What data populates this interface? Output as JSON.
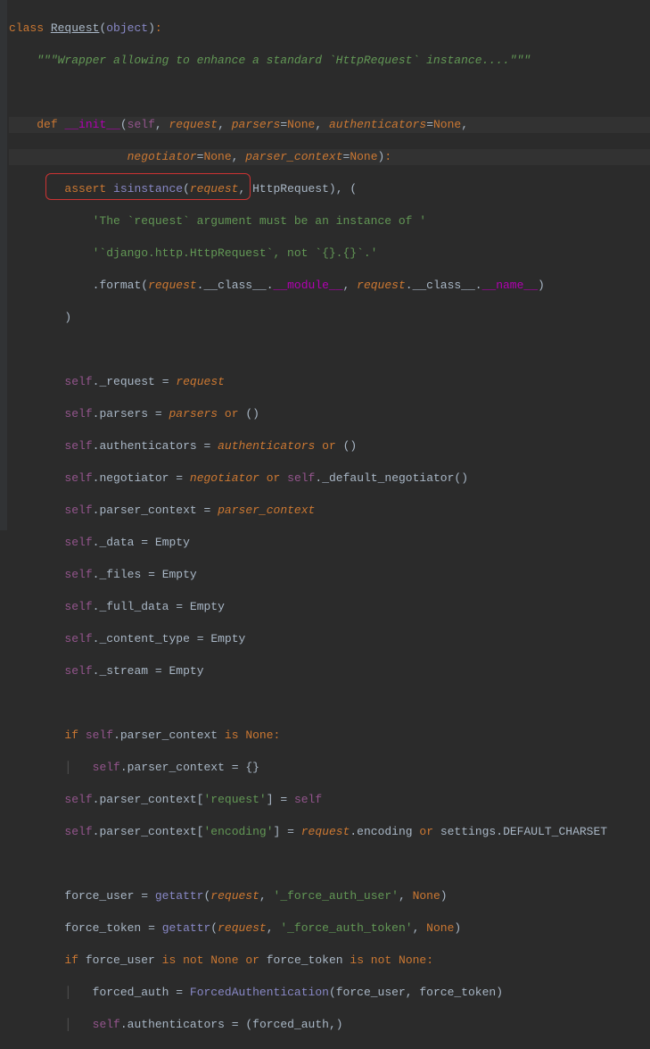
{
  "code": {
    "l1_class": "class",
    "l1_name": "Request",
    "l1_obj": "object",
    "l2_docstr": "\"\"\"Wrapper allowing to enhance a standard `HttpRequest` instance....\"\"\"",
    "l4_def": "def",
    "l4_name": "__init__",
    "l4_self": "self",
    "l4_req": "request",
    "l4_parsers": "parsers",
    "l4_none": "None",
    "l4_auth": "authenticators",
    "l5_neg": "negotiator",
    "l5_pc": "parser_context",
    "l6_assert": "assert",
    "l6_isinst": "isinstance",
    "l6_req": "request",
    "l6_http": "HttpRequest",
    "l7_str": "'The `request` argument must be an instance of '",
    "l8_str": "'`django.http.HttpRequest`, not `{}.{}`.'",
    "l9_format": "format",
    "l9_req": "request",
    "l9_class": "__class__",
    "l9_module": "__module__",
    "l9_name": "__name__",
    "l12_self": "self",
    "l12_req_attr": "_request",
    "l12_req": "request",
    "l13_parsers": "parsers",
    "l13_or": "or",
    "l14_auth": "authenticators",
    "l15_neg": "negotiator",
    "l15_defneg": "_default_negotiator",
    "l16_pc": "parser_context",
    "l17_data": "_data",
    "l17_empty": "Empty",
    "l18_files": "_files",
    "l19_fd": "_full_data",
    "l20_ct": "_content_type",
    "l21_stream": "_stream",
    "l23_if": "if",
    "l23_is": "is",
    "l23_none": "None",
    "l25_reqkey": "'request'",
    "l26_enckey": "'encoding'",
    "l26_enc": "encoding",
    "l26_settings": "settings",
    "l26_def": "DEFAULT_CHARSET",
    "l28_fu": "force_user",
    "l28_getattr": "getattr",
    "l28_key": "'_force_auth_user'",
    "l29_ft": "force_token",
    "l29_key": "'_force_auth_token'",
    "l30_isnot": "is not",
    "l31_fa": "forced_auth",
    "l31_FA": "ForcedAuthentication"
  }
}
